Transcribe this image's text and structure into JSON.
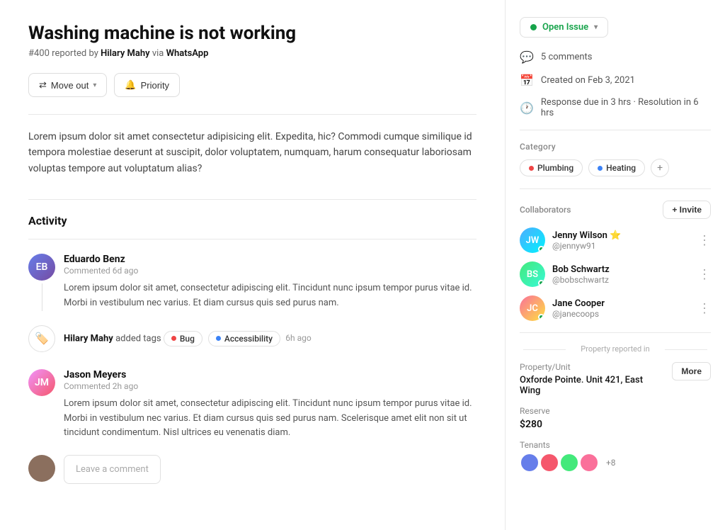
{
  "issue": {
    "title": "Washing machine is not working",
    "id": "#400",
    "reported_by": "Hilary Mahy",
    "via": "WhatsApp",
    "description": "Lorem ipsum dolor sit amet consectetur adipisicing elit. Expedita, hic? Commodi cumque similique id tempora molestiae deserunt at suscipit, dolor voluptatem, numquam, harum consequatur laboriosam voluptas tempore aut voluptatum alias?"
  },
  "buttons": {
    "move_out": "Move out",
    "priority": "Priority"
  },
  "activity": {
    "label": "Activity",
    "items": [
      {
        "id": "comment1",
        "type": "comment",
        "name": "Eduardo Benz",
        "time": "Commented 6d ago",
        "text": "Lorem ipsum dolor sit amet, consectetur adipiscing elit. Tincidunt nunc ipsum tempor purus vitae id. Morbi in vestibulum nec varius. Et diam cursus quis sed purus nam."
      },
      {
        "id": "tag1",
        "type": "tag",
        "name": "Hilary Mahy",
        "action": "added tags",
        "tags": [
          {
            "label": "Bug",
            "color": "#ef4444"
          },
          {
            "label": "Accessibility",
            "color": "#3b82f6"
          }
        ],
        "time": "6h ago"
      },
      {
        "id": "comment2",
        "type": "comment",
        "name": "Jason Meyers",
        "time": "Commented 2h ago",
        "text": "Lorem ipsum dolor sit amet, consectetur adipiscing elit. Tincidunt nunc ipsum tempor purus vitae id. Morbi in vestibulum nec varius. Et diam cursus quis sed purus nam. Scelerisque amet elit non sit ut tincidunt condimentum. Nisl ultrices eu venenatis diam."
      }
    ],
    "comment_placeholder": "Leave a comment"
  },
  "sidebar": {
    "status": "Open Issue",
    "comments": "5 comments",
    "created": "Created on Feb 3, 2021",
    "response": "Response due in 3 hrs · Resolution in 6 hrs",
    "category_label": "Category",
    "categories": [
      {
        "label": "Plumbing",
        "color": "#ef4444"
      },
      {
        "label": "Heating",
        "color": "#3b82f6"
      }
    ],
    "collaborators_label": "Collaborators",
    "invite_label": "+ Invite",
    "collaborators": [
      {
        "name": "Jenny Wilson",
        "handle": "@jennyw91",
        "emoji": "⭐",
        "online": true,
        "initials": "JW"
      },
      {
        "name": "Bob Schwartz",
        "handle": "@bobschwartz",
        "online": true,
        "initials": "BS"
      },
      {
        "name": "Jane Cooper",
        "handle": "@janecoops",
        "online": true,
        "initials": "JC"
      }
    ],
    "property_section": "Property reported in",
    "property_unit_label": "Property/Unit",
    "property_unit_value": "Oxforde Pointe. Unit 421, East Wing",
    "more_label": "More",
    "reserve_label": "Reserve",
    "reserve_value": "$280",
    "tenants_label": "Tenants",
    "tenants_extra": "+8"
  }
}
